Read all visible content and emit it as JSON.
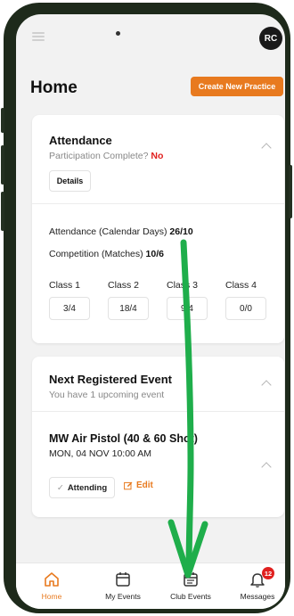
{
  "header": {
    "avatar_initials": "RC"
  },
  "page": {
    "title": "Home",
    "create_button": "Create New Practice"
  },
  "attendance_card": {
    "title": "Attendance",
    "participation_label": "Participation Complete?",
    "participation_value": "No",
    "details_button": "Details",
    "calendar_label": "Attendance (Calendar Days)",
    "calendar_value": "26/10",
    "competition_label": "Competition (Matches)",
    "competition_value": "10/6",
    "classes": [
      {
        "label": "Class 1",
        "value": "3/4"
      },
      {
        "label": "Class 2",
        "value": "18/4"
      },
      {
        "label": "Class 3",
        "value": "9/4"
      },
      {
        "label": "Class 4",
        "value": "0/0"
      }
    ]
  },
  "event_card": {
    "title": "Next Registered Event",
    "subtitle": "You have 1 upcoming event",
    "event_name": "MW Air Pistol (40 & 60 Shot)",
    "event_date": "MON, 04 NOV 10:00 AM",
    "attending_button": "Attending",
    "edit_link": "Edit"
  },
  "bottom_nav": {
    "items": [
      {
        "label": "Home",
        "icon": "home-icon"
      },
      {
        "label": "My Events",
        "icon": "calendar-icon"
      },
      {
        "label": "Club Events",
        "icon": "calendar-list-icon"
      },
      {
        "label": "Messages",
        "icon": "bell-icon"
      }
    ],
    "messages_badge": "12"
  },
  "colors": {
    "accent": "#e87a1f",
    "alert": "#e0201f",
    "annotation_arrow": "#1fae4b",
    "phone_frame": "#1e2a1b"
  }
}
